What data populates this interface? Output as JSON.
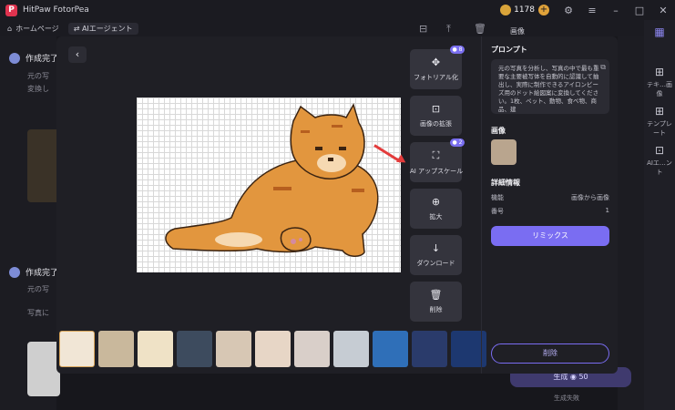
{
  "app": {
    "title": "HitPaw FotorPea",
    "coins": "1178"
  },
  "toolbar": {
    "home": "ホームページ",
    "tab": "AIエージェント"
  },
  "background": {
    "task1_title": "作成完了",
    "task1_line1": "元の写",
    "task1_line2": "変換し",
    "task2_title": "作成完了",
    "task2_line1": "元の写",
    "task2_line2": "写真に",
    "right_label": "画像"
  },
  "side_nav": [
    {
      "icon": "grid-icon",
      "label": "テキ…画像"
    },
    {
      "icon": "template-icon",
      "label": "テンプレート"
    },
    {
      "icon": "agent-icon",
      "label": "AIエ…ント"
    }
  ],
  "modal": {
    "back": "‹",
    "actions": [
      {
        "icon": "✥",
        "label": "フォトリアル化",
        "badge": "8"
      },
      {
        "icon": "⊡",
        "label": "画像の拡張",
        "badge": ""
      },
      {
        "icon": "⛶",
        "label": "AI アップスケール",
        "badge": "2"
      },
      {
        "icon": "⊕",
        "label": "拡大",
        "badge": ""
      },
      {
        "icon": "↓",
        "label": "ダウンロード",
        "badge": ""
      },
      {
        "icon": "🗑",
        "label": "削除",
        "badge": ""
      }
    ],
    "panel": {
      "prompt_heading": "プロンプト",
      "prompt_text": "元の写真を分析し、写真の中で最も重要な主要被写体を自動的に認識して抽出し、実際に制作できるアイロンビーズ用のドット絵図案に変換してください。1枚、ペット、動物、食べ物、商品、建",
      "image_heading": "画像",
      "details_heading": "詳細情報",
      "details": [
        {
          "key": "機能",
          "value": "画像から画像"
        },
        {
          "key": "番号",
          "value": "1"
        }
      ],
      "remix": "リミックス",
      "delete": "削除"
    }
  },
  "generate": {
    "label": "生成",
    "cost": "50",
    "sub": "生成失敗"
  },
  "colors": {
    "accent": "#7a6df2",
    "arrow": "#e33b3b",
    "cat": "#e2963e"
  }
}
